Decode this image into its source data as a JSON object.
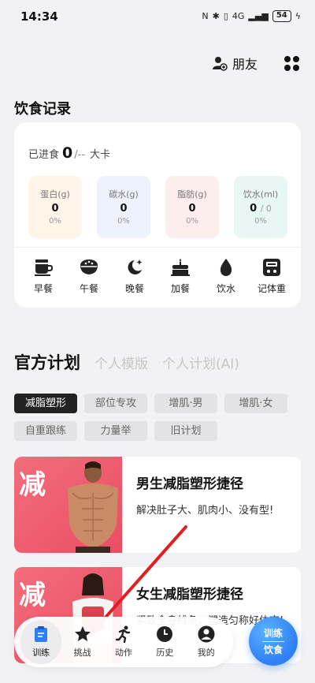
{
  "status_bar": {
    "time": "14:34",
    "network": "4G",
    "battery": "54"
  },
  "header": {
    "friends_label": "朋友"
  },
  "diet": {
    "title": "饮食记录",
    "eaten_label": "已进食",
    "eaten_value": "0",
    "eaten_target": "/--",
    "eaten_unit": "大卡",
    "macros": [
      {
        "label": "蛋白(g)",
        "value": "0",
        "pct": "0%",
        "color": "#fff4e8"
      },
      {
        "label": "碳水(g)",
        "value": "0",
        "pct": "0%",
        "color": "#eef2fd"
      },
      {
        "label": "脂肪(g)",
        "value": "0",
        "pct": "0%",
        "color": "#fdeeee"
      },
      {
        "label": "饮水(ml)",
        "value": "0",
        "sub": "/ 0",
        "pct": "0%",
        "color": "#e8f7f4"
      }
    ],
    "meals": [
      {
        "label": "早餐",
        "icon": "coffee-cup-icon"
      },
      {
        "label": "午餐",
        "icon": "rice-bowl-icon"
      },
      {
        "label": "晚餐",
        "icon": "moon-icon"
      },
      {
        "label": "加餐",
        "icon": "cake-icon"
      },
      {
        "label": "饮水",
        "icon": "water-drop-icon"
      },
      {
        "label": "记体重",
        "icon": "scale-icon"
      }
    ]
  },
  "plans": {
    "tabs": [
      "官方计划",
      "个人模版",
      "个人计划(AI)"
    ],
    "chips": [
      [
        "减脂塑形",
        "部位专攻",
        "增肌·男",
        "增肌·女"
      ],
      [
        "自重跟练",
        "力量举",
        "旧计划"
      ]
    ],
    "cards": [
      {
        "thumb_char": "减",
        "title": "男生减脂塑形捷径",
        "desc": "解决肚子大、肌肉小、没有型!"
      },
      {
        "thumb_char": "减",
        "title": "女生减脂塑形捷径",
        "desc": "紧致全身线条，塑造匀称好体态!"
      }
    ]
  },
  "nav": {
    "items": [
      {
        "label": "训练",
        "icon": "clipboard-icon"
      },
      {
        "label": "挑战",
        "icon": "star-icon"
      },
      {
        "label": "动作",
        "icon": "running-icon"
      },
      {
        "label": "历史",
        "icon": "clock-icon"
      },
      {
        "label": "我的",
        "icon": "person-icon"
      }
    ],
    "fab_line1": "训练",
    "fab_line2": "饮食"
  },
  "colors": {
    "accent": "#2f7ff5",
    "plan_thumb": "#ea4e62",
    "annotation_arrow": "#e02020"
  }
}
